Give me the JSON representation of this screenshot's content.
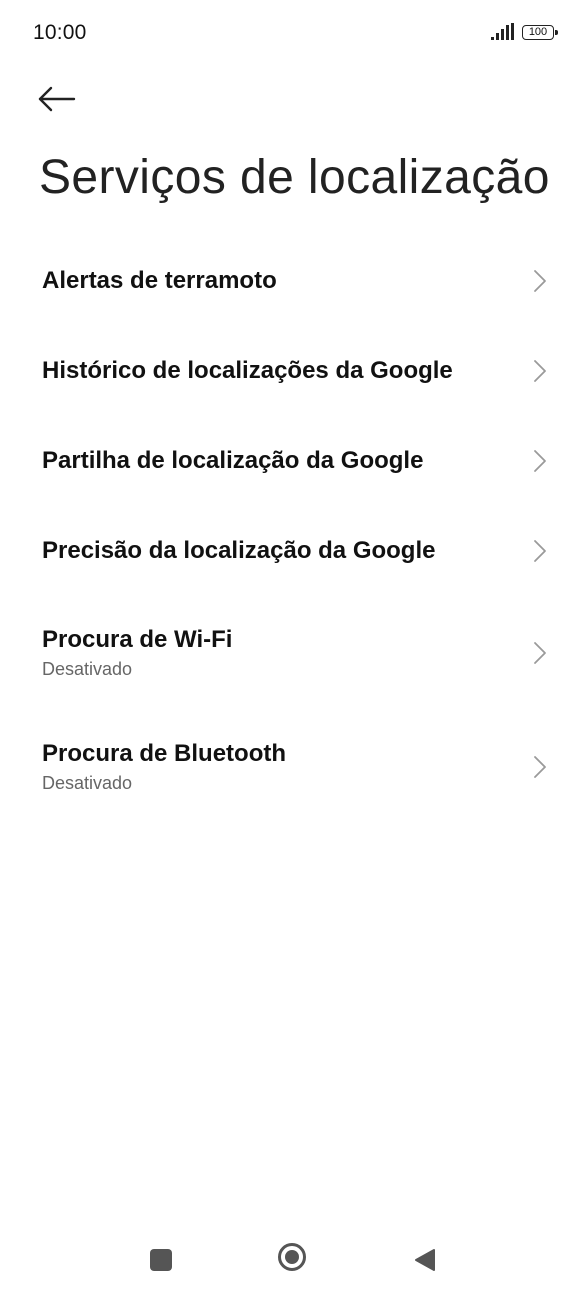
{
  "status_bar": {
    "time": "10:00",
    "signal_icon": "signal-bars-icon",
    "battery_level": "100"
  },
  "header": {
    "back_icon": "arrow-left-icon",
    "title": "Serviços de localização"
  },
  "items": [
    {
      "title": "Alertas de terramoto",
      "subtitle": null
    },
    {
      "title": "Histórico de localizações da Google",
      "subtitle": null
    },
    {
      "title": "Partilha de localização da Google",
      "subtitle": null
    },
    {
      "title": "Precisão da localização da Google",
      "subtitle": null
    },
    {
      "title": "Procura de Wi-Fi",
      "subtitle": "Desativado"
    },
    {
      "title": "Procura de Bluetooth",
      "subtitle": "Desativado"
    }
  ],
  "navigation": {
    "recents_icon": "square-icon",
    "home_icon": "circle-icon",
    "back_icon": "triangle-back-icon"
  },
  "colors": {
    "background": "#ffffff",
    "title_text": "#222222",
    "item_text": "#111111",
    "subtitle_text": "#666666",
    "chevron": "#9a9a9a",
    "nav_icons": "#555555"
  }
}
